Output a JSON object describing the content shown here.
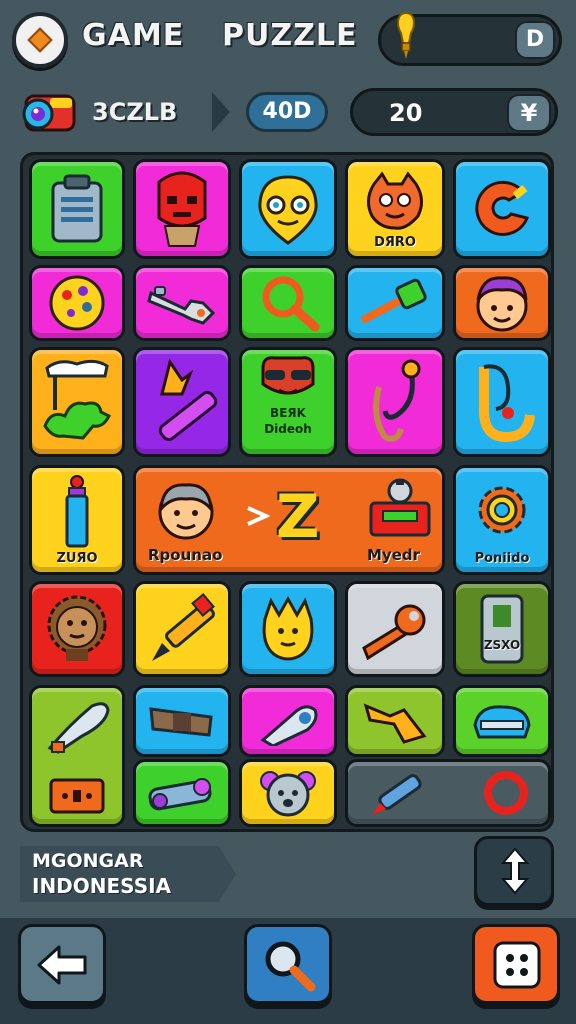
{
  "header": {
    "title_left": "GAME",
    "title_right": "PUZZLE",
    "energy_play_label": "D"
  },
  "stats": {
    "code": "3CZLB",
    "score": "40D",
    "coins": "20",
    "coin_button": "¥"
  },
  "tiles": {
    "t_robot_label": "DЯRO",
    "t_bear_label_1": "BEЯK",
    "t_bear_label_2": "Dideoh",
    "t_bottle_label": "ZUЯO",
    "t_wide_left_label": "Rpounao",
    "t_wide_right_label": "Myedr",
    "t_gear_label": "Poniido",
    "t_card_label": "ZSXO",
    "t_wide_letter": "Z"
  },
  "banner": {
    "line1": "MGONGAR",
    "line2": "INDONESSIA"
  },
  "colors": {
    "background": "#46585f",
    "board": "#263238",
    "accent_blue": "#2f7fc2",
    "accent_orange": "#f05a1f"
  },
  "icons": {
    "back": "arrow-left-icon",
    "search": "magnifier-icon",
    "dice": "dice-icon",
    "swap": "vertical-arrows-icon",
    "energy": "lightbulb-icon"
  }
}
